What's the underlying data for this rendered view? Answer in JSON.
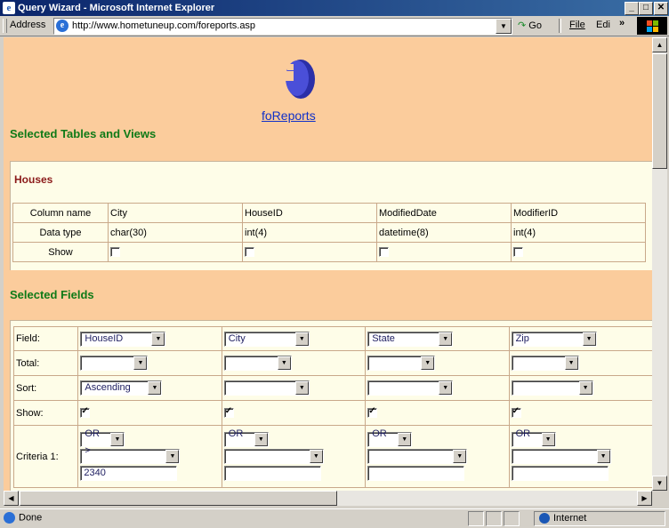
{
  "window": {
    "title": "Query Wizard - Microsoft Internet Explorer",
    "minimize": "_",
    "maximize": "□",
    "close": "✕"
  },
  "toolbar": {
    "address_label": "Address",
    "url": "http://www.hometuneup.com/foreports.asp",
    "go_label": "Go",
    "menu_file": "File",
    "menu_edit": "Edi",
    "chevron": "»"
  },
  "brand": {
    "logo_link": "foReports"
  },
  "sections": {
    "tables_title": "Selected Tables and Views",
    "fields_title": "Selected Fields"
  },
  "houses": {
    "label": "Houses",
    "row_labels": [
      "Column name",
      "Data type",
      "Show"
    ],
    "columns": [
      "City",
      "HouseID",
      "ModifiedDate",
      "ModifierID"
    ],
    "types": [
      "char(30)",
      "int(4)",
      "datetime(8)",
      "int(4)"
    ],
    "show": [
      false,
      false,
      false,
      false
    ]
  },
  "fields": {
    "row_labels": {
      "field": "Field:",
      "total": "Total:",
      "sort": "Sort:",
      "show": "Show:",
      "criteria": "Criteria 1:"
    },
    "columns": [
      {
        "field": "HouseID",
        "total": "",
        "sort": "Ascending",
        "show": true,
        "logic": "OR",
        "operator": ">",
        "value": "2340"
      },
      {
        "field": "City",
        "total": "",
        "sort": "",
        "show": true,
        "logic": "OR",
        "operator": "",
        "value": ""
      },
      {
        "field": "State",
        "total": "",
        "sort": "",
        "show": true,
        "logic": "OR",
        "operator": "",
        "value": ""
      },
      {
        "field": "Zip",
        "total": "",
        "sort": "",
        "show": true,
        "logic": "OR",
        "operator": "",
        "value": ""
      }
    ]
  },
  "status": {
    "text": "Done",
    "zone": "Internet"
  },
  "colors": {
    "page_bg": "#fbcc9c",
    "panel_bg": "#fefde8",
    "section_title": "#0f7a17",
    "houses_label": "#8b1a1a",
    "link": "#1030c8",
    "titlebar": "#0a246a"
  },
  "icons": [
    "ie-icon",
    "page-icon",
    "go-arrow-icon",
    "windows-logo-icon",
    "scroll-up-icon",
    "scroll-down-icon",
    "scroll-left-icon",
    "scroll-right-icon",
    "globe-icon",
    "forereports-logo-icon"
  ]
}
